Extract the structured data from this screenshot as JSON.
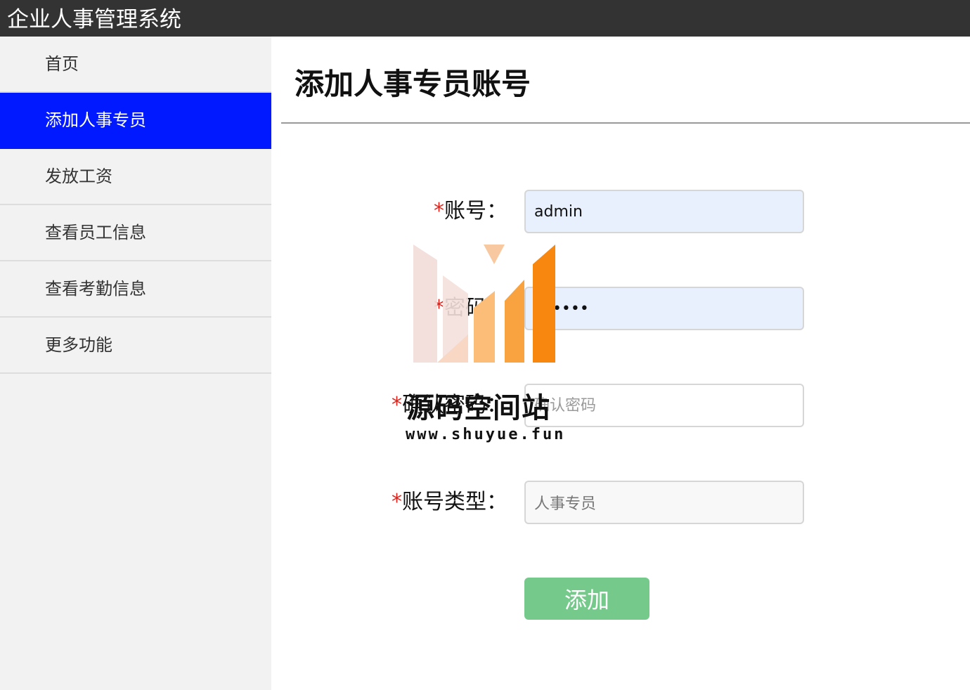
{
  "app": {
    "title": "企业人事管理系统"
  },
  "sidebar": {
    "items": [
      {
        "label": "首页"
      },
      {
        "label": "添加人事专员",
        "active": true
      },
      {
        "label": "发放工资"
      },
      {
        "label": "查看员工信息"
      },
      {
        "label": "查看考勤信息"
      },
      {
        "label": "更多功能"
      }
    ]
  },
  "main": {
    "page_title": "添加人事专员账号",
    "form": {
      "required_mark": "*",
      "account": {
        "label": "账号：",
        "value": "admin"
      },
      "password": {
        "label": "密码：",
        "value": "••••••"
      },
      "confirm": {
        "label": "确认密码：",
        "placeholder": "确认密码"
      },
      "type": {
        "label": "账号类型：",
        "value": "人事专员"
      },
      "submit_label": "添加"
    }
  },
  "watermark": {
    "title": "源码空间站",
    "url": "www.shuyue.fun"
  },
  "colors": {
    "topbar": "#333333",
    "sidebar_bg": "#f2f2f2",
    "active_nav": "#0019ff",
    "required": "#e8231b",
    "submit": "#74c98b",
    "autofill_bg": "#e8f0fe"
  }
}
